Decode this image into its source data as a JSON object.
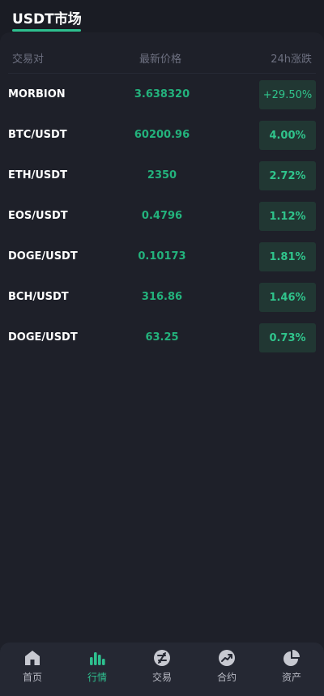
{
  "header": {
    "title": "USDT市场"
  },
  "table": {
    "col_pair": "交易对",
    "col_price": "最新价格",
    "col_change": "24h涨跌",
    "rows": [
      {
        "pair": "MORBION",
        "price": "3.638320",
        "change": "+29.50%"
      },
      {
        "pair": "BTC/USDT",
        "price": "60200.96",
        "change": "4.00%"
      },
      {
        "pair": "ETH/USDT",
        "price": "2350",
        "change": "2.72%"
      },
      {
        "pair": "EOS/USDT",
        "price": "0.4796",
        "change": "1.12%"
      },
      {
        "pair": "DOGE/USDT",
        "price": "0.10173",
        "change": "1.81%"
      },
      {
        "pair": "BCH/USDT",
        "price": "316.86",
        "change": "1.46%"
      },
      {
        "pair": "DOGE/USDT",
        "price": "63.25",
        "change": "0.73%"
      }
    ]
  },
  "tabbar": {
    "items": [
      {
        "label": "首页",
        "icon": "home-icon"
      },
      {
        "label": "行情",
        "icon": "market-bars-icon",
        "active": true
      },
      {
        "label": "交易",
        "icon": "trade-icon"
      },
      {
        "label": "合约",
        "icon": "contract-trend-icon"
      },
      {
        "label": "资产",
        "icon": "assets-pie-icon"
      }
    ]
  },
  "colors": {
    "background": "#1a1c24",
    "accent_green": "#2ec08f",
    "change_badge_bg": "#213733"
  }
}
